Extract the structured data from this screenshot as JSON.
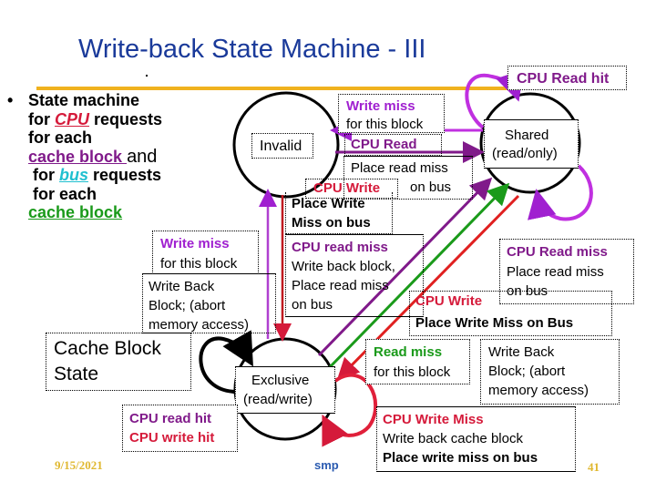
{
  "slide": {
    "title": "Write-back State Machine - III",
    "footer": {
      "date": "9/15/2021",
      "center": "smp",
      "page_number": "41"
    }
  },
  "bullet": {
    "marker": "•",
    "line1": "State machine",
    "line2_prefix": "for ",
    "line2_cpu": "CPU",
    "line2_suffix": " requests",
    "line3": "for each",
    "line4_link": "cache block ",
    "line4_suffix": "and",
    "line5_prefix": "for ",
    "line5_bus": "bus",
    "line5_suffix": " requests",
    "line6": "for each",
    "line7_link": "cache block"
  },
  "states": {
    "invalid": "Invalid",
    "shared_line1": "Shared",
    "shared_line2": "(read/only)",
    "exclusive_line1": "Exclusive",
    "exclusive_line2": "(read/write)"
  },
  "legend": {
    "line1": "Cache Block",
    "line2": "State"
  },
  "transitions": {
    "cpu_read_hit": "CPU Read hit",
    "write_miss_top": {
      "event": "Write miss",
      "detail": "for this block"
    },
    "cpu_read_invalid": {
      "event": "CPU Read",
      "action1": "Place read miss",
      "action2": "on bus"
    },
    "cpu_write_invalid": {
      "event": "CPU Write",
      "action1": "Place Write",
      "action2": "Miss on bus"
    },
    "cpu_read_miss_excl": {
      "event": "CPU read miss",
      "action1": "Write back block,",
      "action2": "Place read miss",
      "action3": "on bus"
    },
    "write_miss_left": {
      "event": "Write miss",
      "detail": "for this block"
    },
    "write_back_left": {
      "line1": "Write Back",
      "line2": "Block; (abort",
      "line3": "memory access)"
    },
    "cpu_read_miss_shared": {
      "event": "CPU Read miss",
      "action1": "Place read miss",
      "action2": "on bus"
    },
    "cpu_write_shared": {
      "event": "CPU Write",
      "action": "Place Write Miss on Bus"
    },
    "read_miss_bus": {
      "event": "Read miss",
      "detail": "for this block"
    },
    "write_back_right": {
      "line1": "Write Back",
      "line2": "Block; (abort",
      "line3": "memory access)"
    },
    "cpu_write_miss_excl": {
      "event": "CPU Write Miss",
      "action1": "Write back cache block",
      "action2": "Place write miss on bus"
    },
    "excl_hits": {
      "line1": "CPU read hit",
      "line2": "CPU write hit"
    }
  },
  "colors": {
    "title": "#1a3a9a",
    "rule": "#f0b21e",
    "purple": "#a020d0",
    "dark_purple": "#801a8a",
    "red": "#d51a3a",
    "green": "#1a9a1a",
    "cyan": "#20c0d0"
  }
}
